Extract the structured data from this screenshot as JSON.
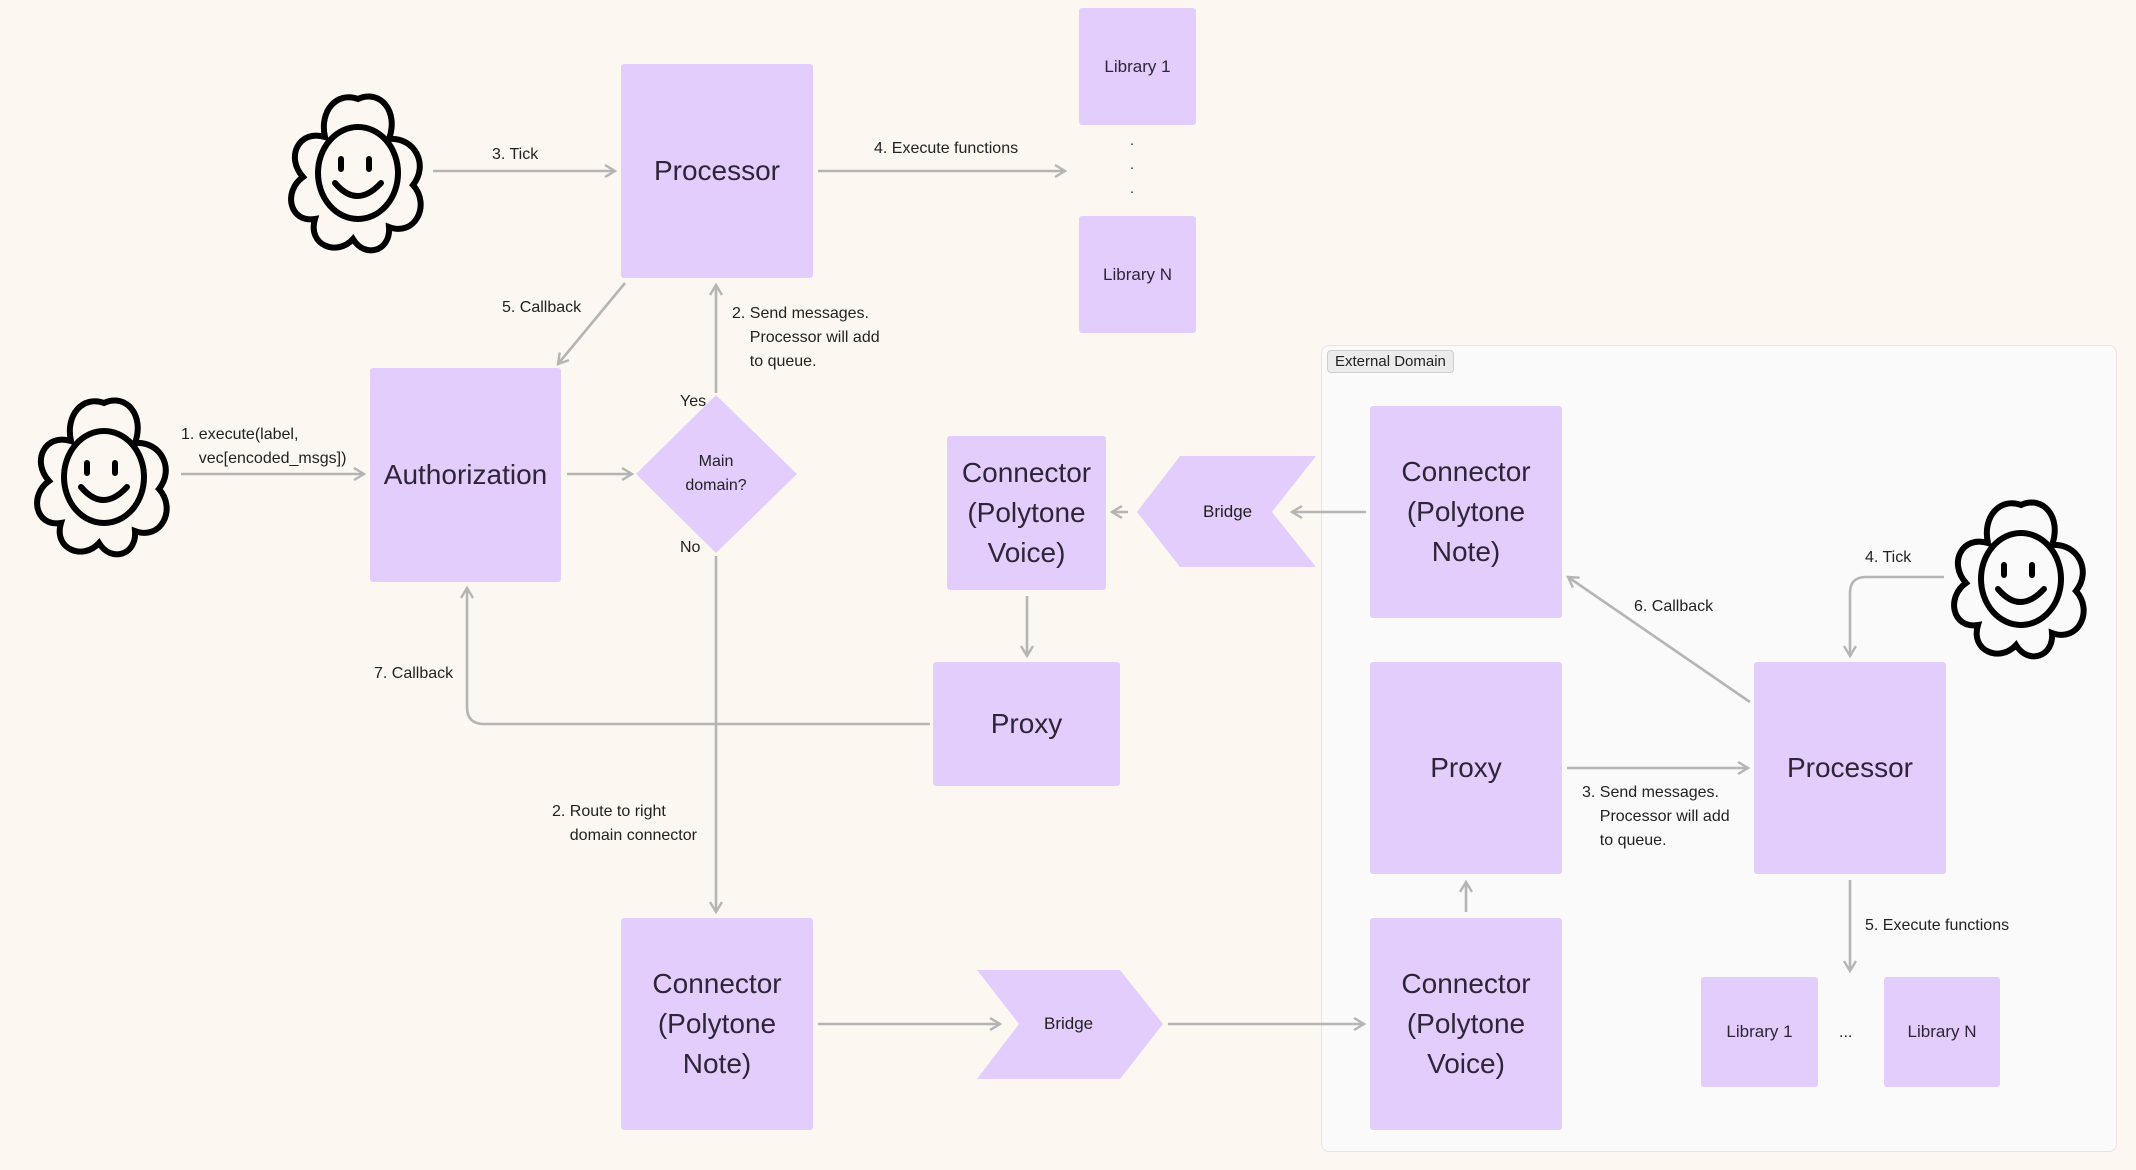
{
  "external_domain": {
    "label": "External Domain"
  },
  "nodes": {
    "processor_main": "Processor",
    "library_1_main": "Library 1",
    "library_n_main": "Library N",
    "library_dots_main": ".\n.\n.",
    "authorization": "Authorization",
    "decision": "Main\ndomain?",
    "decision_yes": "Yes",
    "decision_no": "No",
    "connector_voice_main": "Connector\n(Polytone\nVoice)",
    "bridge_upper": "Bridge",
    "connector_note_ext": "Connector\n(Polytone\nNote)",
    "proxy_main": "Proxy",
    "proxy_ext": "Proxy",
    "processor_ext": "Processor",
    "connector_note_main": "Connector\n(Polytone\nNote)",
    "bridge_lower": "Bridge",
    "connector_voice_ext": "Connector\n(Polytone\nVoice)",
    "library_1_ext": "Library 1",
    "library_n_ext": "Library N",
    "library_dots_ext": "..."
  },
  "edges": {
    "tick_main": "3. Tick",
    "execute_main": "4. Execute functions",
    "callback_5": "5. Callback",
    "send_messages_main": "2. Send messages.\n    Processor will add\n    to queue.",
    "execute_call": "1. execute(label,\n    vec[encoded_msgs])",
    "callback_7": "7. Callback",
    "route": "2. Route to right\n    domain connector",
    "tick_ext": "4. Tick",
    "callback_6": "6. Callback",
    "send_messages_ext": "3. Send messages.\n    Processor will add\n    to queue.",
    "execute_ext": "5. Execute functions"
  },
  "actors": [
    "user-flower",
    "ticker-flower-main",
    "ticker-flower-external"
  ],
  "colors": {
    "node_fill": "#e3cdfd",
    "edge": "#b5b5b5",
    "background": "#fdf7f1",
    "frame": "#fafafa"
  }
}
